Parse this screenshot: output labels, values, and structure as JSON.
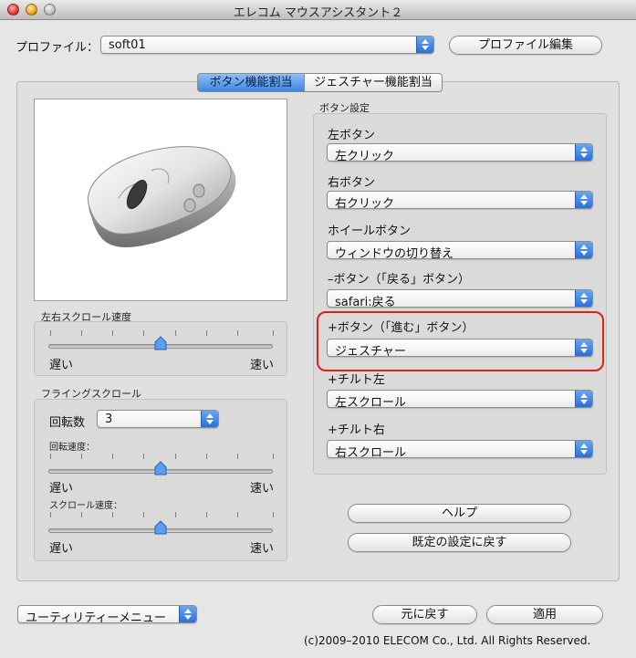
{
  "window": {
    "title": "エレコム マウスアシスタント２"
  },
  "profile": {
    "label": "プロファイル：",
    "value": "soft01",
    "edit_button": "プロファイル編集"
  },
  "tabs": [
    {
      "label": "ボタン機能割当",
      "active": true
    },
    {
      "label": "ジェスチャー機能割当",
      "active": false
    }
  ],
  "button_settings": {
    "title": "ボタン設定",
    "rows": [
      {
        "label": "左ボタン",
        "value": "左クリック"
      },
      {
        "label": "右ボタン",
        "value": "右クリック"
      },
      {
        "label": "ホイールボタン",
        "value": "ウィンドウの切り替え"
      },
      {
        "label": "–ボタン（「戻る」ボタン）",
        "value": "safari:戻る"
      },
      {
        "label": "+ボタン（「進む」ボタン）",
        "value": "ジェスチャー"
      },
      {
        "label": "+チルト左",
        "value": "左スクロール"
      },
      {
        "label": "+チルト右",
        "value": "右スクロール"
      }
    ]
  },
  "horizontal_scroll": {
    "title": "左右スクロール速度",
    "slow": "遅い",
    "fast": "速い",
    "level": 0.5
  },
  "flying_scroll": {
    "title": "フライングスクロール",
    "rotation_label": "回転数",
    "rotation_value": "3",
    "rotation_speed_label": "回転速度：",
    "scroll_speed_label": "スクロール速度：",
    "slow": "遅い",
    "fast": "速い",
    "rotation_speed_level": 0.5,
    "scroll_speed_level": 0.5
  },
  "buttons": {
    "help": "ヘルプ",
    "restore_defaults": "既定の設定に戻す",
    "revert": "元に戻す",
    "apply": "適用"
  },
  "utility_menu": {
    "value": "ユーティリティーメニュー"
  },
  "footer": {
    "copyright": "(c)2009–2010 ELECOM Co., Ltd. All Rights Reserved."
  },
  "colors": {
    "accent": "#3d86e4",
    "highlight": "#e0201a"
  }
}
